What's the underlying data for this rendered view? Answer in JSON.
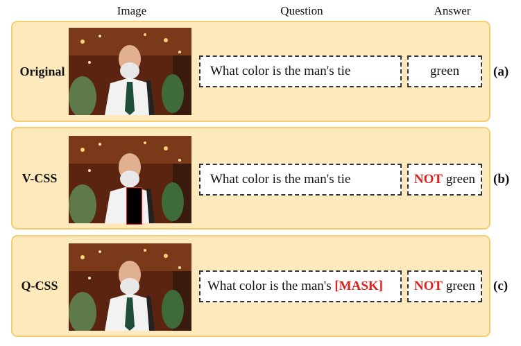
{
  "headers": {
    "image": "Image",
    "question": "Question",
    "answer": "Answer"
  },
  "rows": [
    {
      "label": "Original",
      "question": "What color is the man's tie",
      "answer_prefix": "",
      "answer": "green",
      "tag": "(a)"
    },
    {
      "label": "V-CSS",
      "question": "What color is the man's tie",
      "answer_prefix": "NOT",
      "answer": "green",
      "tag": "(b)"
    },
    {
      "label": "Q-CSS",
      "question": "What color is the man's",
      "question_mask": "[MASK]",
      "answer_prefix": "NOT",
      "answer": "green",
      "tag": "(c)"
    }
  ],
  "colors": {
    "panel": "#fde9bb",
    "panel_border": "#f3cd6e",
    "highlight": "#e0201b"
  }
}
